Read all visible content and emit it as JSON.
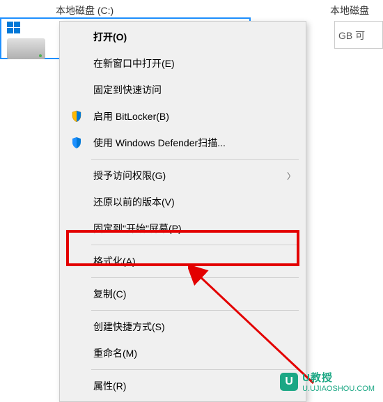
{
  "drives": {
    "c_label": "本地磁盘 (C:)",
    "right_label": "本地磁盘",
    "right_fragment": "GB 可"
  },
  "menu": {
    "open": "打开(O)",
    "open_new_window": "在新窗口中打开(E)",
    "pin_quick_access": "固定到快速访问",
    "bitlocker": "启用 BitLocker(B)",
    "defender_scan": "使用 Windows Defender扫描...",
    "grant_access": "授予访问权限(G)",
    "restore_versions": "还原以前的版本(V)",
    "pin_start": "固定到\"开始\"屏幕(P)",
    "format": "格式化(A)...",
    "copy": "复制(C)",
    "create_shortcut": "创建快捷方式(S)",
    "rename": "重命名(M)",
    "properties": "属性(R)"
  },
  "watermark": {
    "brand": "U教授",
    "url": "U.UJIAOSHOU.COM",
    "logo_letter": "U"
  }
}
